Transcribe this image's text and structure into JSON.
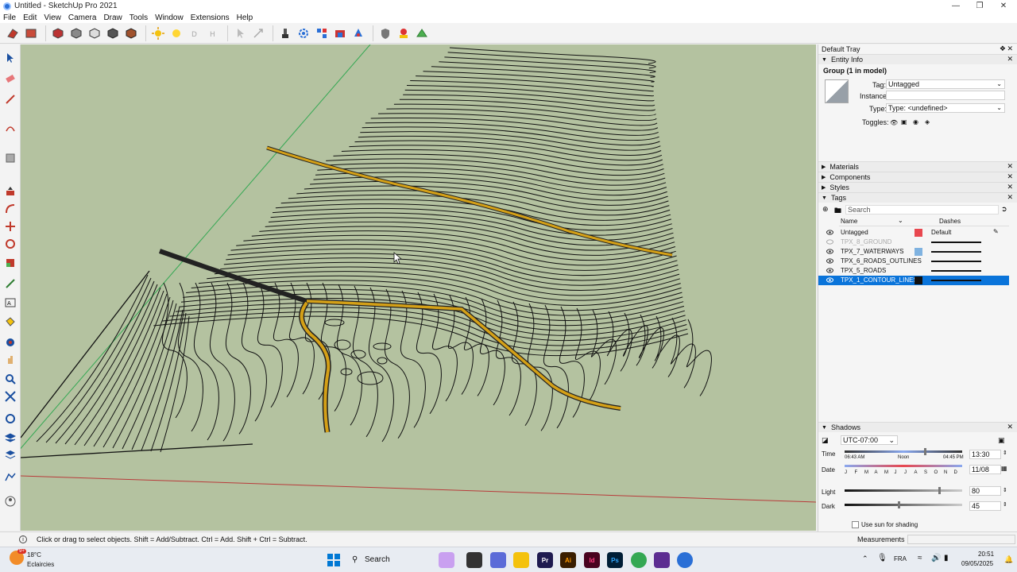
{
  "window": {
    "title": "Untitled - SketchUp Pro 2021"
  },
  "menu": [
    "File",
    "Edit",
    "View",
    "Camera",
    "Draw",
    "Tools",
    "Window",
    "Extensions",
    "Help"
  ],
  "toolbar_icons": [
    "section-icon",
    "section-display-icon",
    "section-fill-icon",
    "xray-icon",
    "wireframe-icon",
    "hidden-line-icon",
    "shaded-icon",
    "sun-icon",
    "sun-shadow-icon",
    "fog-icon",
    "edge-icon",
    "select-icon",
    "move-icon",
    "paint-icon",
    "gear-icon",
    "components-icon",
    "warehouse-icon",
    "extension-icon",
    "shield-icon",
    "addlocation-icon",
    "sandbox-icon"
  ],
  "tools_left": [
    "select-icon",
    "eraser-icon",
    "pencil-icon",
    "arc-icon",
    "rectangle-icon",
    "pushpull-icon",
    "offset-icon",
    "move-icon",
    "rotate-icon",
    "scale-icon",
    "tape-icon",
    "text-icon",
    "paint-icon",
    "orbit-icon",
    "pan-icon",
    "zoom-icon",
    "zoom-extents-icon",
    "section-icon",
    "layers-icon",
    "stack-icon",
    "sandbox-icon",
    "user-icon"
  ],
  "tray": {
    "title": "Default Tray",
    "entity_info": {
      "header": "Entity Info",
      "entity": "Group (1 in model)",
      "tag_label": "Tag:",
      "tag_value": "Untagged",
      "instance_label": "Instance:",
      "instance_value": "",
      "type_label": "Type:",
      "type_value": "Type: <undefined>",
      "toggles_label": "Toggles:"
    },
    "panels_collapsed": [
      "Materials",
      "Components",
      "Styles"
    ],
    "tags": {
      "header": "Tags",
      "search_placeholder": "Search",
      "col_name": "Name",
      "col_dashes": "Dashes",
      "rows": [
        {
          "name": "Untagged",
          "color": "#e8474f",
          "dashes": "Default",
          "visible": true,
          "selected": false
        },
        {
          "name": "TPX_8_GROUND",
          "color": "",
          "dashes": "",
          "visible": false,
          "selected": false
        },
        {
          "name": "TPX_7_WATERWAYS",
          "color": "#7fb2e0",
          "dashes": "",
          "visible": true,
          "selected": false
        },
        {
          "name": "TPX_6_ROADS_OUTLINES",
          "color": "",
          "dashes": "",
          "visible": true,
          "selected": false
        },
        {
          "name": "TPX_5_ROADS",
          "color": "",
          "dashes": "",
          "visible": true,
          "selected": false
        },
        {
          "name": "TPX_1_CONTOUR_LINES",
          "color": "#111111",
          "dashes": "",
          "visible": true,
          "selected": true
        }
      ]
    },
    "shadows": {
      "header": "Shadows",
      "timezone": "UTC-07:00",
      "time_label": "Time",
      "sunrise": "06:43 AM",
      "noon": "Noon",
      "sunset": "04:45 PM",
      "time_value": "13:30",
      "date_label": "Date",
      "months": [
        "J",
        "F",
        "M",
        "A",
        "M",
        "J",
        "J",
        "A",
        "S",
        "O",
        "N",
        "D"
      ],
      "date_value": "11/08",
      "light_label": "Light",
      "light_value": "80",
      "light_level": 80,
      "dark_label": "Dark",
      "dark_value": "45",
      "dark_level": 45,
      "use_sun_label": "Use sun for shading"
    }
  },
  "status": {
    "message": "Click or drag to select objects. Shift = Add/Subtract. Ctrl = Add. Shift + Ctrl = Subtract."
  },
  "measurements": {
    "label": "Measurements",
    "value": ""
  },
  "taskbar": {
    "weather_temp": "18°C",
    "weather_desc": "Eclaircies",
    "weather_badge": "9+",
    "search_label": "Search",
    "lang": "FRA",
    "time": "20:51",
    "date": "09/05/2025"
  },
  "colors": {
    "viewport_bg": "#b4c2a0",
    "road": "#d4a017",
    "selection": "#0a74da"
  }
}
